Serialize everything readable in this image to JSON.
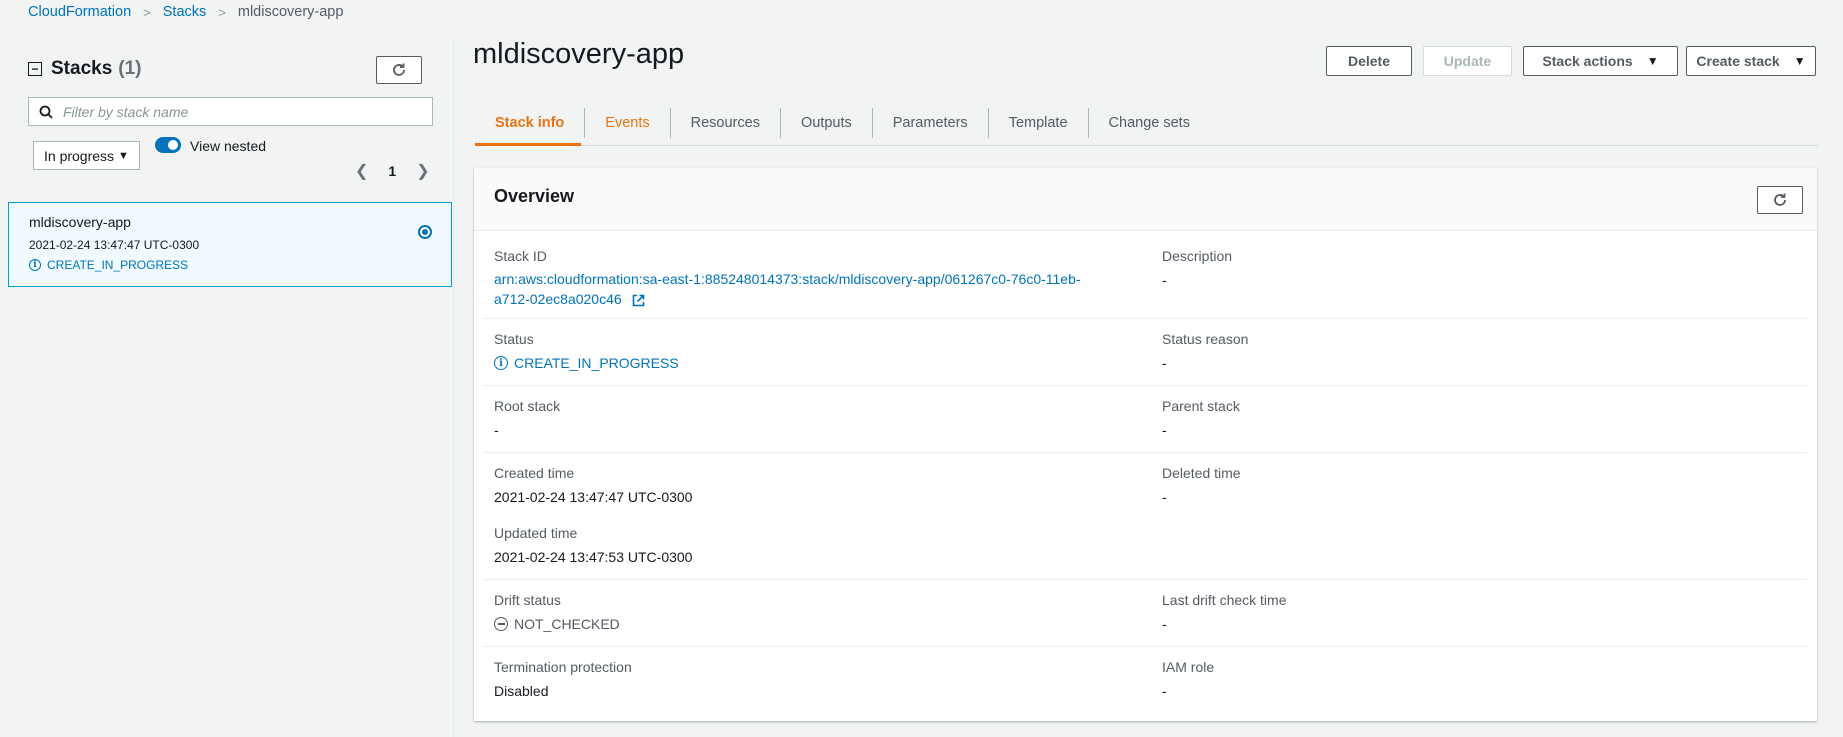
{
  "breadcrumb": {
    "items": [
      "CloudFormation",
      "Stacks"
    ],
    "current": "mldiscovery-app"
  },
  "sidebar": {
    "title": "Stacks",
    "count": "(1)",
    "search_placeholder": "Filter by stack name",
    "filter_value": "In progress",
    "toggle_label": "View nested",
    "toggle_on": true,
    "page": "1",
    "stacks": [
      {
        "name": "mldiscovery-app",
        "time": "2021-02-24 13:47:47 UTC-0300",
        "status": "CREATE_IN_PROGRESS",
        "selected": true
      }
    ]
  },
  "main": {
    "title": "mldiscovery-app",
    "buttons": {
      "delete": "Delete",
      "update": "Update",
      "stack_actions": "Stack actions",
      "create_stack": "Create stack"
    },
    "tabs": [
      "Stack info",
      "Events",
      "Resources",
      "Outputs",
      "Parameters",
      "Template",
      "Change sets"
    ],
    "active_tab": "Stack info"
  },
  "overview": {
    "title": "Overview",
    "stack_id_label": "Stack ID",
    "stack_id": "arn:aws:cloudformation:sa-east-1:885248014373:stack/mldiscovery-app/061267c0-76c0-11eb-",
    "stack_id_line2": "a712-02ec8a020c46",
    "description_label": "Description",
    "description": "-",
    "status_label": "Status",
    "status": "CREATE_IN_PROGRESS",
    "status_reason_label": "Status reason",
    "status_reason": "-",
    "root_stack_label": "Root stack",
    "root_stack": "-",
    "parent_stack_label": "Parent stack",
    "parent_stack": "-",
    "created_time_label": "Created time",
    "created_time": "2021-02-24 13:47:47 UTC-0300",
    "deleted_time_label": "Deleted time",
    "deleted_time": "-",
    "updated_time_label": "Updated time",
    "updated_time": "2021-02-24 13:47:53 UTC-0300",
    "drift_status_label": "Drift status",
    "drift_status": "NOT_CHECKED",
    "last_drift_label": "Last drift check time",
    "last_drift": "-",
    "termination_label": "Termination protection",
    "termination": "Disabled",
    "iam_role_label": "IAM role",
    "iam_role": "-"
  },
  "colors": {
    "accent": "#ec7211",
    "link": "#0073bb",
    "background": "#f2f3f3"
  }
}
